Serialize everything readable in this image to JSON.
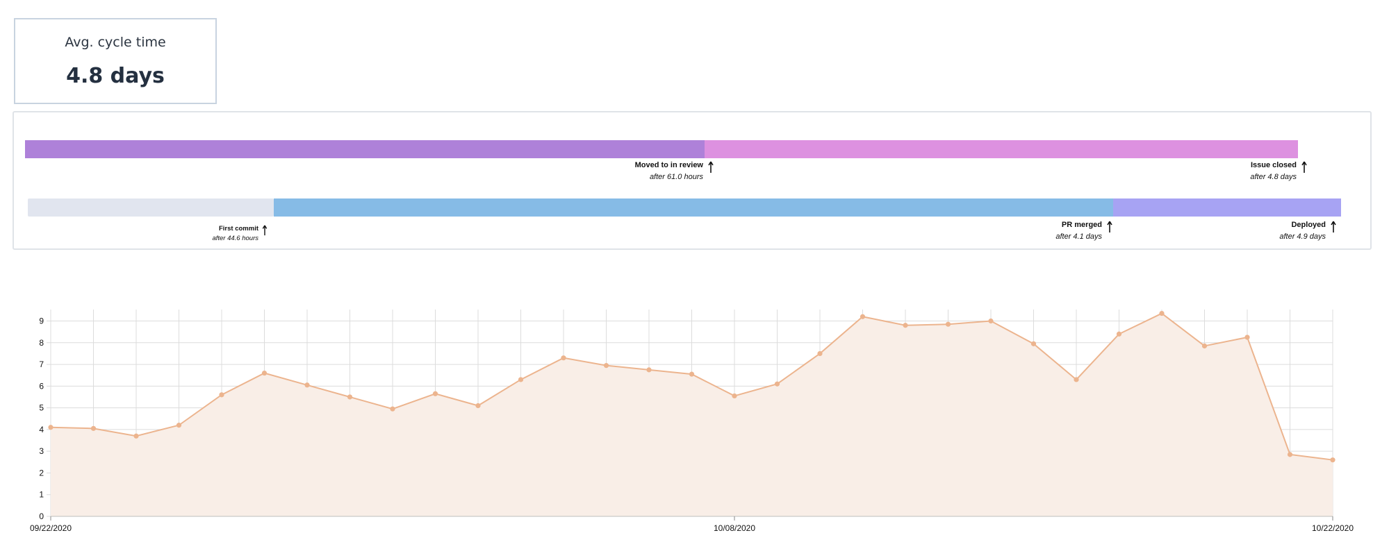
{
  "summary": {
    "label": "Avg. cycle time",
    "value": "4.8 days"
  },
  "timeline": {
    "issue_row": {
      "segments": [
        {
          "color": "#ae81d9"
        },
        {
          "color": "#dd91e0"
        }
      ],
      "markers": [
        {
          "label": "Moved to in review",
          "sub": "after 61.0 hours"
        },
        {
          "label": "Issue closed",
          "sub": "after 4.8 days"
        }
      ]
    },
    "pr_row": {
      "segments": [
        {
          "color": "#e1e5ef"
        },
        {
          "color": "#86bbe6"
        },
        {
          "color": "#a7a3f3"
        }
      ],
      "markers": [
        {
          "label": "First commit",
          "sub": "after 44.6 hours"
        },
        {
          "label": "PR merged",
          "sub": "after 4.1 days"
        },
        {
          "label": "Deployed",
          "sub": "after 4.9 days"
        }
      ]
    }
  },
  "chart_data": {
    "type": "area",
    "title": "",
    "xlabel": "",
    "ylabel": "",
    "ylim": [
      0,
      9.4
    ],
    "yticks": [
      0,
      1,
      2,
      3,
      4,
      5,
      6,
      7,
      8,
      9
    ],
    "xtick_labels": [
      "09/22/2020",
      "10/08/2020",
      "10/22/2020"
    ],
    "x": [
      "09/22/2020",
      "09/23/2020",
      "09/24/2020",
      "09/25/2020",
      "09/26/2020",
      "09/27/2020",
      "09/28/2020",
      "09/29/2020",
      "09/30/2020",
      "10/01/2020",
      "10/02/2020",
      "10/03/2020",
      "10/04/2020",
      "10/05/2020",
      "10/06/2020",
      "10/07/2020",
      "10/08/2020",
      "10/09/2020",
      "10/10/2020",
      "10/11/2020",
      "10/12/2020",
      "10/13/2020",
      "10/14/2020",
      "10/15/2020",
      "10/16/2020",
      "10/17/2020",
      "10/18/2020",
      "10/19/2020",
      "10/20/2020",
      "10/21/2020",
      "10/22/2020"
    ],
    "values": [
      4.1,
      4.05,
      3.7,
      4.2,
      5.6,
      6.6,
      6.05,
      5.5,
      4.95,
      5.65,
      5.1,
      6.3,
      7.3,
      6.95,
      6.75,
      6.55,
      5.55,
      6.1,
      7.5,
      9.2,
      8.8,
      8.85,
      9.0,
      7.95,
      6.3,
      8.4,
      9.35,
      7.85,
      8.25,
      2.85,
      2.6
    ],
    "grid": true,
    "colors": {
      "line": "#ecb48e",
      "fill": "#f9eee7",
      "grid": "#dcdcdc"
    }
  }
}
